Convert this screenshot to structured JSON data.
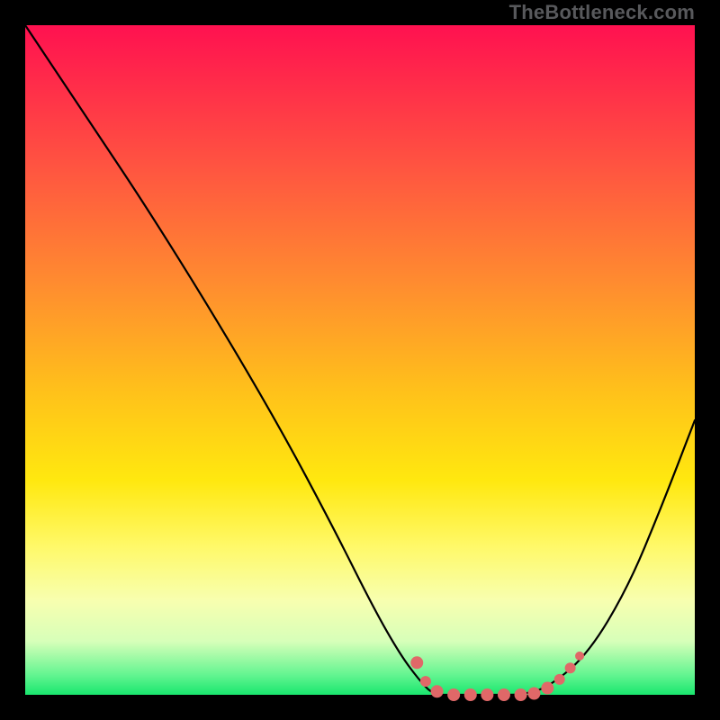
{
  "attribution": "TheBottleneck.com",
  "chart_data": {
    "type": "line",
    "title": "",
    "xlabel": "",
    "ylabel": "",
    "xlim": [
      0,
      100
    ],
    "ylim": [
      0,
      100
    ],
    "grid": false,
    "legend": false,
    "series": [
      {
        "name": "curve",
        "x": [
          0,
          4,
          10,
          18,
          28,
          38,
          46,
          52,
          56,
          59,
          61,
          64,
          70,
          74,
          78,
          84,
          90,
          95,
          100
        ],
        "y": [
          100,
          94,
          85,
          73,
          57,
          40,
          25,
          13,
          6,
          2,
          0,
          0,
          0,
          0,
          1,
          6,
          16,
          28,
          41
        ],
        "stroke": "#000000",
        "width": 2.2
      }
    ],
    "markers": [
      {
        "x": 58.5,
        "y": 4.8,
        "r": 7
      },
      {
        "x": 59.8,
        "y": 2.0,
        "r": 6
      },
      {
        "x": 61.5,
        "y": 0.5,
        "r": 7
      },
      {
        "x": 64.0,
        "y": 0.0,
        "r": 7
      },
      {
        "x": 66.5,
        "y": 0.0,
        "r": 7
      },
      {
        "x": 69.0,
        "y": 0.0,
        "r": 7
      },
      {
        "x": 71.5,
        "y": 0.0,
        "r": 7
      },
      {
        "x": 74.0,
        "y": 0.0,
        "r": 7
      },
      {
        "x": 76.0,
        "y": 0.2,
        "r": 7
      },
      {
        "x": 78.0,
        "y": 1.0,
        "r": 7
      },
      {
        "x": 79.8,
        "y": 2.3,
        "r": 6
      },
      {
        "x": 81.4,
        "y": 4.0,
        "r": 6
      },
      {
        "x": 82.8,
        "y": 5.8,
        "r": 5
      }
    ],
    "marker_fill": "#e06868",
    "gradient_stops": [
      {
        "pos": 0,
        "color": "#ff1150"
      },
      {
        "pos": 8,
        "color": "#ff2a4a"
      },
      {
        "pos": 22,
        "color": "#ff5740"
      },
      {
        "pos": 38,
        "color": "#ff8a30"
      },
      {
        "pos": 55,
        "color": "#ffc21a"
      },
      {
        "pos": 68,
        "color": "#ffe80f"
      },
      {
        "pos": 78,
        "color": "#fff96a"
      },
      {
        "pos": 86,
        "color": "#f7ffb0"
      },
      {
        "pos": 92,
        "color": "#d7ffb9"
      },
      {
        "pos": 97,
        "color": "#64f591"
      },
      {
        "pos": 100,
        "color": "#19e66e"
      }
    ]
  }
}
